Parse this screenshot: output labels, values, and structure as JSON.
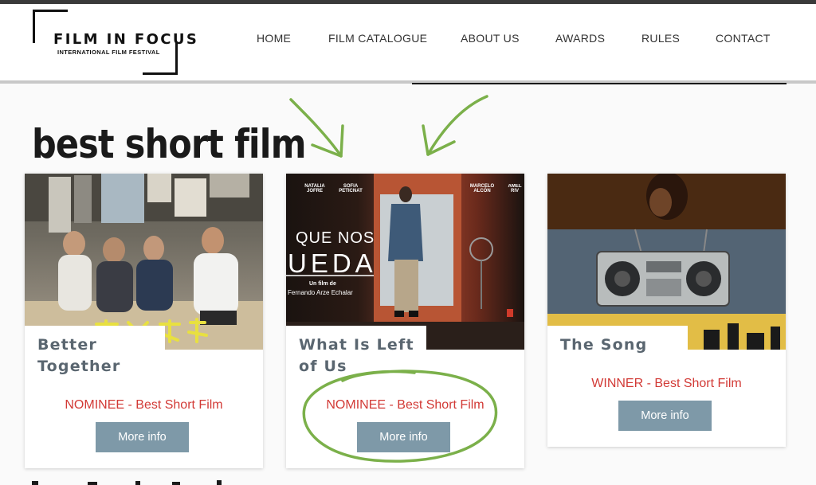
{
  "header": {
    "logo_title": "FILM IN FOCUS",
    "logo_subtitle": "INTERNATIONAL FILM FESTIVAL",
    "nav": [
      "HOME",
      "FILM CATALOGUE",
      "ABOUT US",
      "AWARDS",
      "RULES",
      "CONTACT"
    ]
  },
  "section": {
    "title": "best short film"
  },
  "cards": [
    {
      "title_lines": [
        "Better",
        "Together"
      ],
      "award": "NOMINEE - Best Short Film",
      "button": "More info"
    },
    {
      "title_lines": [
        "What Is Left",
        "of Us"
      ],
      "award": "NOMINEE - Best Short Film",
      "button": "More info",
      "poster": {
        "names": [
          "NATALIA JOFRE",
          "SOFIA PETICNAT",
          "MARCELO ALCÓN",
          "AMEL RIV"
        ],
        "title_a": "QUE NOS",
        "title_b": "UEDA",
        "byline": "Un film de",
        "director": "Fernando Arze Echalar"
      }
    },
    {
      "title_lines": [
        "The Song"
      ],
      "award": "WINNER - Best Short Film",
      "button": "More info"
    }
  ],
  "colors": {
    "award_red": "#d23a36",
    "button_bg": "#7e99a8",
    "title_gray": "#5a6670",
    "annotation_green": "#7bb04a"
  }
}
